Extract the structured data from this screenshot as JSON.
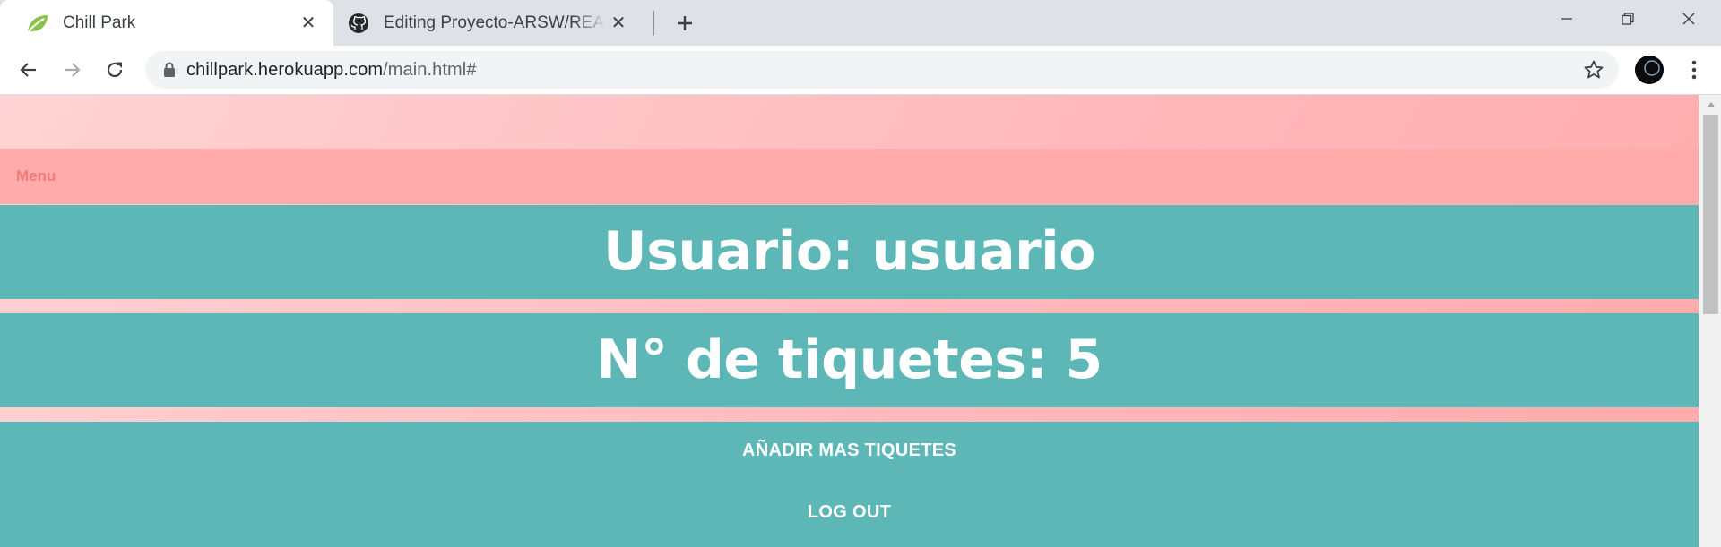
{
  "browser": {
    "tabs": [
      {
        "title": "Chill Park",
        "active": true,
        "icon": "spring-leaf-icon"
      },
      {
        "title": "Editing Proyecto-ARSW/README.md",
        "active": false,
        "icon": "github-icon"
      }
    ],
    "url_host": "chillpark.herokuapp.com",
    "url_path": "/main.html#"
  },
  "page": {
    "menu_label": "Menu",
    "user_line": "Usuario: usuario",
    "tickets_line": "N° de tiquetes: 5",
    "add_tickets_label": "AÑADIR MAS TIQUETES",
    "logout_label": "LOG OUT"
  },
  "colors": {
    "teal": "#5eb7b7",
    "pink": "#ffabab",
    "menu_text": "#f27a7a"
  }
}
